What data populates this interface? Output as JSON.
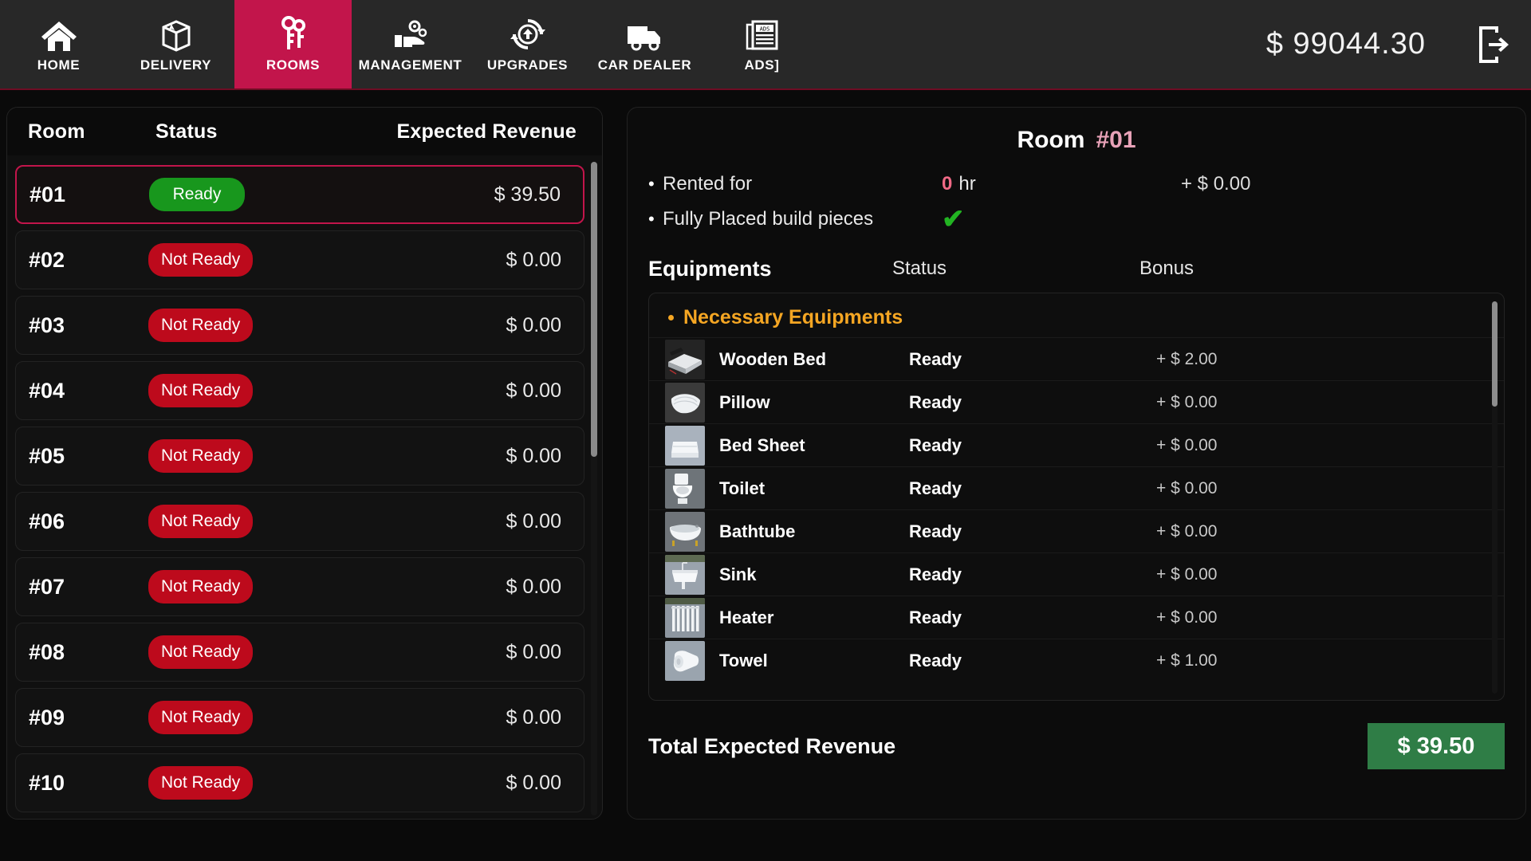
{
  "topnav": {
    "items": [
      {
        "label": "HOME",
        "icon": "home-icon",
        "active": false
      },
      {
        "label": "DELIVERY",
        "icon": "package-icon",
        "active": false
      },
      {
        "label": "ROOMS",
        "icon": "keys-icon",
        "active": true
      },
      {
        "label": "MANAGEMENT",
        "icon": "hand-gear-icon",
        "active": false
      },
      {
        "label": "UPGRADES",
        "icon": "upgrade-icon",
        "active": false
      },
      {
        "label": "CAR DEALER",
        "icon": "truck-icon",
        "active": false
      },
      {
        "label": "ADS]",
        "icon": "newspaper-icon",
        "active": false
      }
    ],
    "money": "$ 99044.30",
    "logout_icon": "logout-icon",
    "active_color": "#c2154b"
  },
  "rooms_panel": {
    "columns": {
      "room": "Room",
      "status": "Status",
      "revenue": "Expected Revenue"
    },
    "rows": [
      {
        "room": "#01",
        "status": "Ready",
        "status_kind": "ready",
        "revenue": "$ 39.50",
        "selected": true
      },
      {
        "room": "#02",
        "status": "Not Ready",
        "status_kind": "notready",
        "revenue": "$ 0.00",
        "selected": false
      },
      {
        "room": "#03",
        "status": "Not Ready",
        "status_kind": "notready",
        "revenue": "$ 0.00",
        "selected": false
      },
      {
        "room": "#04",
        "status": "Not Ready",
        "status_kind": "notready",
        "revenue": "$ 0.00",
        "selected": false
      },
      {
        "room": "#05",
        "status": "Not Ready",
        "status_kind": "notready",
        "revenue": "$ 0.00",
        "selected": false
      },
      {
        "room": "#06",
        "status": "Not Ready",
        "status_kind": "notready",
        "revenue": "$ 0.00",
        "selected": false
      },
      {
        "room": "#07",
        "status": "Not Ready",
        "status_kind": "notready",
        "revenue": "$ 0.00",
        "selected": false
      },
      {
        "room": "#08",
        "status": "Not Ready",
        "status_kind": "notready",
        "revenue": "$ 0.00",
        "selected": false
      },
      {
        "room": "#09",
        "status": "Not Ready",
        "status_kind": "notready",
        "revenue": "$ 0.00",
        "selected": false
      },
      {
        "room": "#10",
        "status": "Not Ready",
        "status_kind": "notready",
        "revenue": "$ 0.00",
        "selected": false
      }
    ]
  },
  "detail": {
    "title": "Room",
    "room_number": "#01",
    "rented_label": "Rented for",
    "rented_hours": "0",
    "rented_unit": "hr",
    "rented_amount": "+ $ 0.00",
    "build_label": "Fully Placed build pieces",
    "build_check": "✔",
    "eq_columns": {
      "name": "Equipments",
      "status": "Status",
      "bonus": "Bonus"
    },
    "group_title": "Necessary Equipments",
    "equipments": [
      {
        "name": "Wooden Bed",
        "status": "Ready",
        "bonus": "+ $ 2.00",
        "icon": "wooden-bed-thumb"
      },
      {
        "name": "Pillow",
        "status": "Ready",
        "bonus": "+ $ 0.00",
        "icon": "pillow-thumb"
      },
      {
        "name": "Bed Sheet",
        "status": "Ready",
        "bonus": "+ $ 0.00",
        "icon": "bed-sheet-thumb"
      },
      {
        "name": "Toilet",
        "status": "Ready",
        "bonus": "+ $ 0.00",
        "icon": "toilet-thumb"
      },
      {
        "name": "Bathtube",
        "status": "Ready",
        "bonus": "+ $ 0.00",
        "icon": "bathtub-thumb"
      },
      {
        "name": "Sink",
        "status": "Ready",
        "bonus": "+ $ 0.00",
        "icon": "sink-thumb"
      },
      {
        "name": "Heater",
        "status": "Ready",
        "bonus": "+ $ 0.00",
        "icon": "heater-thumb"
      },
      {
        "name": "Towel",
        "status": "Ready",
        "bonus": "+ $ 1.00",
        "icon": "towel-thumb"
      }
    ],
    "total_label": "Total Expected Revenue",
    "total_value": "$ 39.50",
    "total_color": "#2f7d46"
  }
}
